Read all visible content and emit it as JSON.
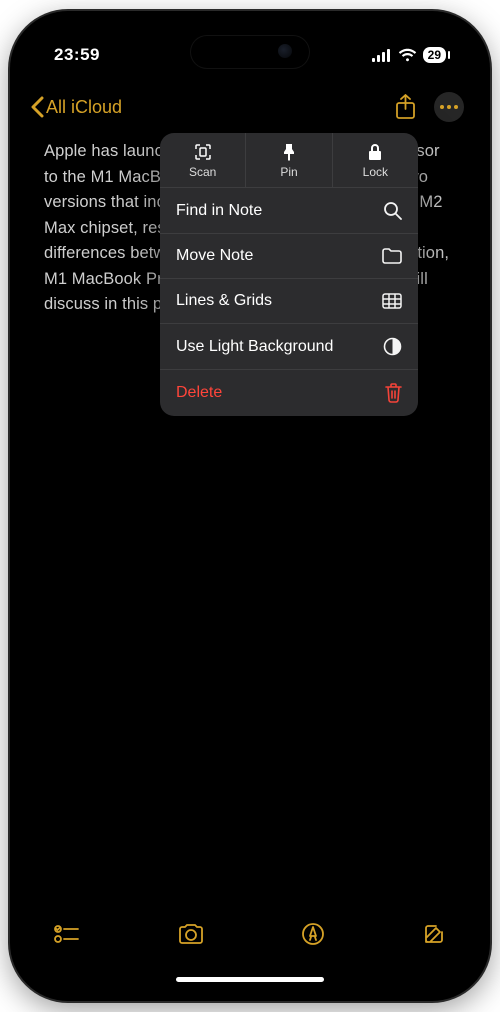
{
  "status": {
    "time": "23:59",
    "battery": "29"
  },
  "nav": {
    "back_label": "All iCloud"
  },
  "note_body": "Apple has launched the MacBook Pro as a successor to the M1 MacBook Pro. The new computer has two versions that include a new M2 Pro processor and M2 Max chipset, respectively. If you are wondering the differences between these two and the last generation, M1 MacBook Pro, then that is precisely what we will discuss in this post.",
  "popover": {
    "top": [
      {
        "label": "Scan",
        "name": "scan"
      },
      {
        "label": "Pin",
        "name": "pin"
      },
      {
        "label": "Lock",
        "name": "lock"
      }
    ],
    "rows": [
      {
        "label": "Find in Note",
        "icon": "search"
      },
      {
        "label": "Move Note",
        "icon": "folder"
      },
      {
        "label": "Lines & Grids",
        "icon": "grid"
      },
      {
        "label": "Use Light Background",
        "icon": "contrast"
      }
    ],
    "delete_label": "Delete"
  },
  "colors": {
    "accent": "#d6a227",
    "destructive": "#ff453a",
    "menu_bg": "#2c2c2e"
  }
}
